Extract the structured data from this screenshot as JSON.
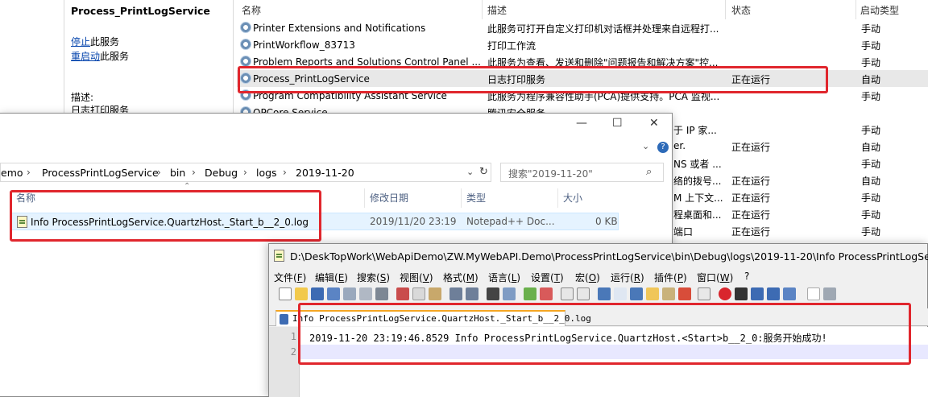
{
  "services": {
    "selected_title": "Process_PrintLogService",
    "stop_link": "停止",
    "stop_rest": "此服务",
    "restart_link": "重启动",
    "restart_rest": "此服务",
    "desc_label": "描述:",
    "desc_text": "日志打印服务",
    "columns": {
      "name": "名称",
      "desc": "描述",
      "status": "状态",
      "startup": "启动类型"
    },
    "rows": [
      {
        "name": "Printer Extensions and Notifications",
        "desc": "此服务可打开自定义打印机对话框并处理来自远程打...",
        "status": "",
        "startup": "手动"
      },
      {
        "name": "PrintWorkflow_83713",
        "desc": "打印工作流",
        "status": "",
        "startup": "手动"
      },
      {
        "name": "Problem Reports and Solutions Control Panel ...",
        "desc": "此服务为查看、发送和删除\"问题报告和解决方案\"控...",
        "status": "",
        "startup": "手动"
      },
      {
        "name": "Process_PrintLogService",
        "desc": "日志打印服务",
        "status": "正在运行",
        "startup": "自动"
      },
      {
        "name": "Program Compatibility Assistant Service",
        "desc": "此服务为程序兼容性助手(PCA)提供支持。PCA 监视...",
        "status": "",
        "startup": "手动"
      },
      {
        "name": "QPCore Service",
        "desc": "腾讯安全服务",
        "status": "",
        "startup": ""
      }
    ],
    "partial_rows": [
      {
        "desc": "于 IP 家...",
        "status": "",
        "startup": "手动"
      },
      {
        "desc": "er.",
        "status": "正在运行",
        "startup": "自动"
      },
      {
        "desc": "NS 或者 ...",
        "status": "",
        "startup": "手动"
      },
      {
        "desc": "络的拨号...",
        "status": "正在运行",
        "startup": "自动"
      },
      {
        "desc": "M 上下文...",
        "status": "正在运行",
        "startup": "手动"
      },
      {
        "desc": "程桌面和...",
        "status": "正在运行",
        "startup": "手动"
      },
      {
        "desc": "端口",
        "status": "正在运行",
        "startup": "手动"
      }
    ],
    "top_startup": "手动"
  },
  "explorer": {
    "controls": {
      "minimize": "—",
      "maximize": "☐",
      "close": "✕"
    },
    "breadcrumb": [
      "emo",
      "ProcessPrintLogService",
      "bin",
      "Debug",
      "logs",
      "2019-11-20"
    ],
    "search_placeholder": "搜索\"2019-11-20\"",
    "columns": {
      "name": "名称",
      "modified": "修改日期",
      "type": "类型",
      "size": "大小"
    },
    "file": {
      "name": "Info ProcessPrintLogService.QuartzHost._Start_b__2_0.log",
      "modified": "2019/11/20 23:19",
      "type": "Notepad++ Doc...",
      "size": "0 KB"
    }
  },
  "notepad": {
    "title": "D:\\DeskTopWork\\WebApiDemo\\ZW.MyWebAPI.Demo\\ProcessPrintLogService\\bin\\Debug\\logs\\2019-11-20\\Info ProcessPrintLogService.",
    "menu": [
      {
        "label": "文件(",
        "key": "F",
        "end": ")"
      },
      {
        "label": "编辑(",
        "key": "E",
        "end": ")"
      },
      {
        "label": "搜索(",
        "key": "S",
        "end": ")"
      },
      {
        "label": "视图(",
        "key": "V",
        "end": ")"
      },
      {
        "label": "格式(",
        "key": "M",
        "end": ")"
      },
      {
        "label": "语言(",
        "key": "L",
        "end": ")"
      },
      {
        "label": "设置(",
        "key": "T",
        "end": ")"
      },
      {
        "label": "宏(",
        "key": "O",
        "end": ")"
      },
      {
        "label": "运行(",
        "key": "R",
        "end": ")"
      },
      {
        "label": "插件(",
        "key": "P",
        "end": ")"
      },
      {
        "label": "窗口(",
        "key": "W",
        "end": ")"
      },
      {
        "label": "?",
        "key": "",
        "end": ""
      }
    ],
    "tab_label": "Info ProcessPrintLogService.QuartzHost._Start_b__2_0.log",
    "line_numbers": [
      "1",
      "2"
    ],
    "lines": [
      "2019-11-20 23:19:46.8529 Info ProcessPrintLogService.QuartzHost.<Start>b__2_0:服务开始成功!",
      ""
    ]
  }
}
